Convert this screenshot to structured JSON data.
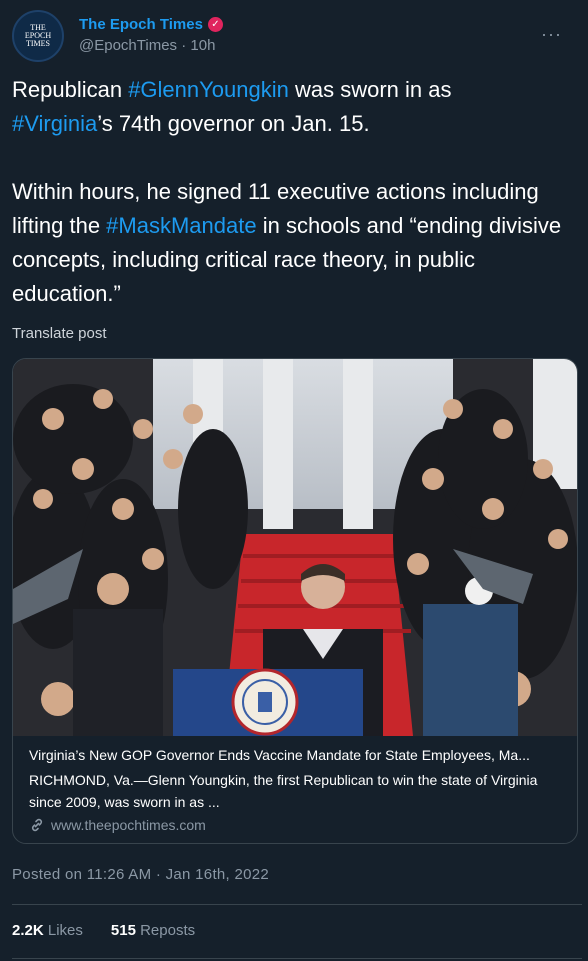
{
  "author": {
    "avatar_text": [
      "THE",
      "EPOCH",
      "TIMES"
    ],
    "display_name": "The Epoch Times",
    "verified_icon": "verified-badge-icon",
    "handle": "@EpochTimes",
    "time_ago": "10h",
    "more_icon": "more-options-icon",
    "more_label": "···"
  },
  "post": {
    "p1_a": "Republican ",
    "p1_tag1": "#GlennYoungkin",
    "p1_b": " was sworn in as",
    "p1_tag2": "#Virginia",
    "p1_c": "’s 74th governor on Jan. 15.",
    "p2_a": "Within hours, he signed 11 executive actions including lifting the ",
    "p2_tag": "#MaskMandate",
    "p2_b": " in schools and “ending divisive concepts, including critical race theory, in public education.”",
    "translate": "Translate post"
  },
  "card": {
    "title": "Virginia’s New GOP Governor Ends Vaccine Mandate for State Employees, Ma...",
    "description": "RICHMOND, Va.—Glenn Youngkin, the first Republican to win the state of Virginia since 2009, was sworn in as ...",
    "domain": "www.theepochtimes.com",
    "link_icon": "link-icon"
  },
  "footer": {
    "posted_on": "Posted on 11:26 AM · Jan 16th, 2022",
    "likes_count": "2.2K",
    "likes_label": "Likes",
    "reposts_count": "515",
    "reposts_label": "Reposts"
  },
  "colors": {
    "background": "#15202b",
    "accent": "#1d9bf0",
    "muted": "#8b98a5",
    "verified": "#e0245e"
  }
}
